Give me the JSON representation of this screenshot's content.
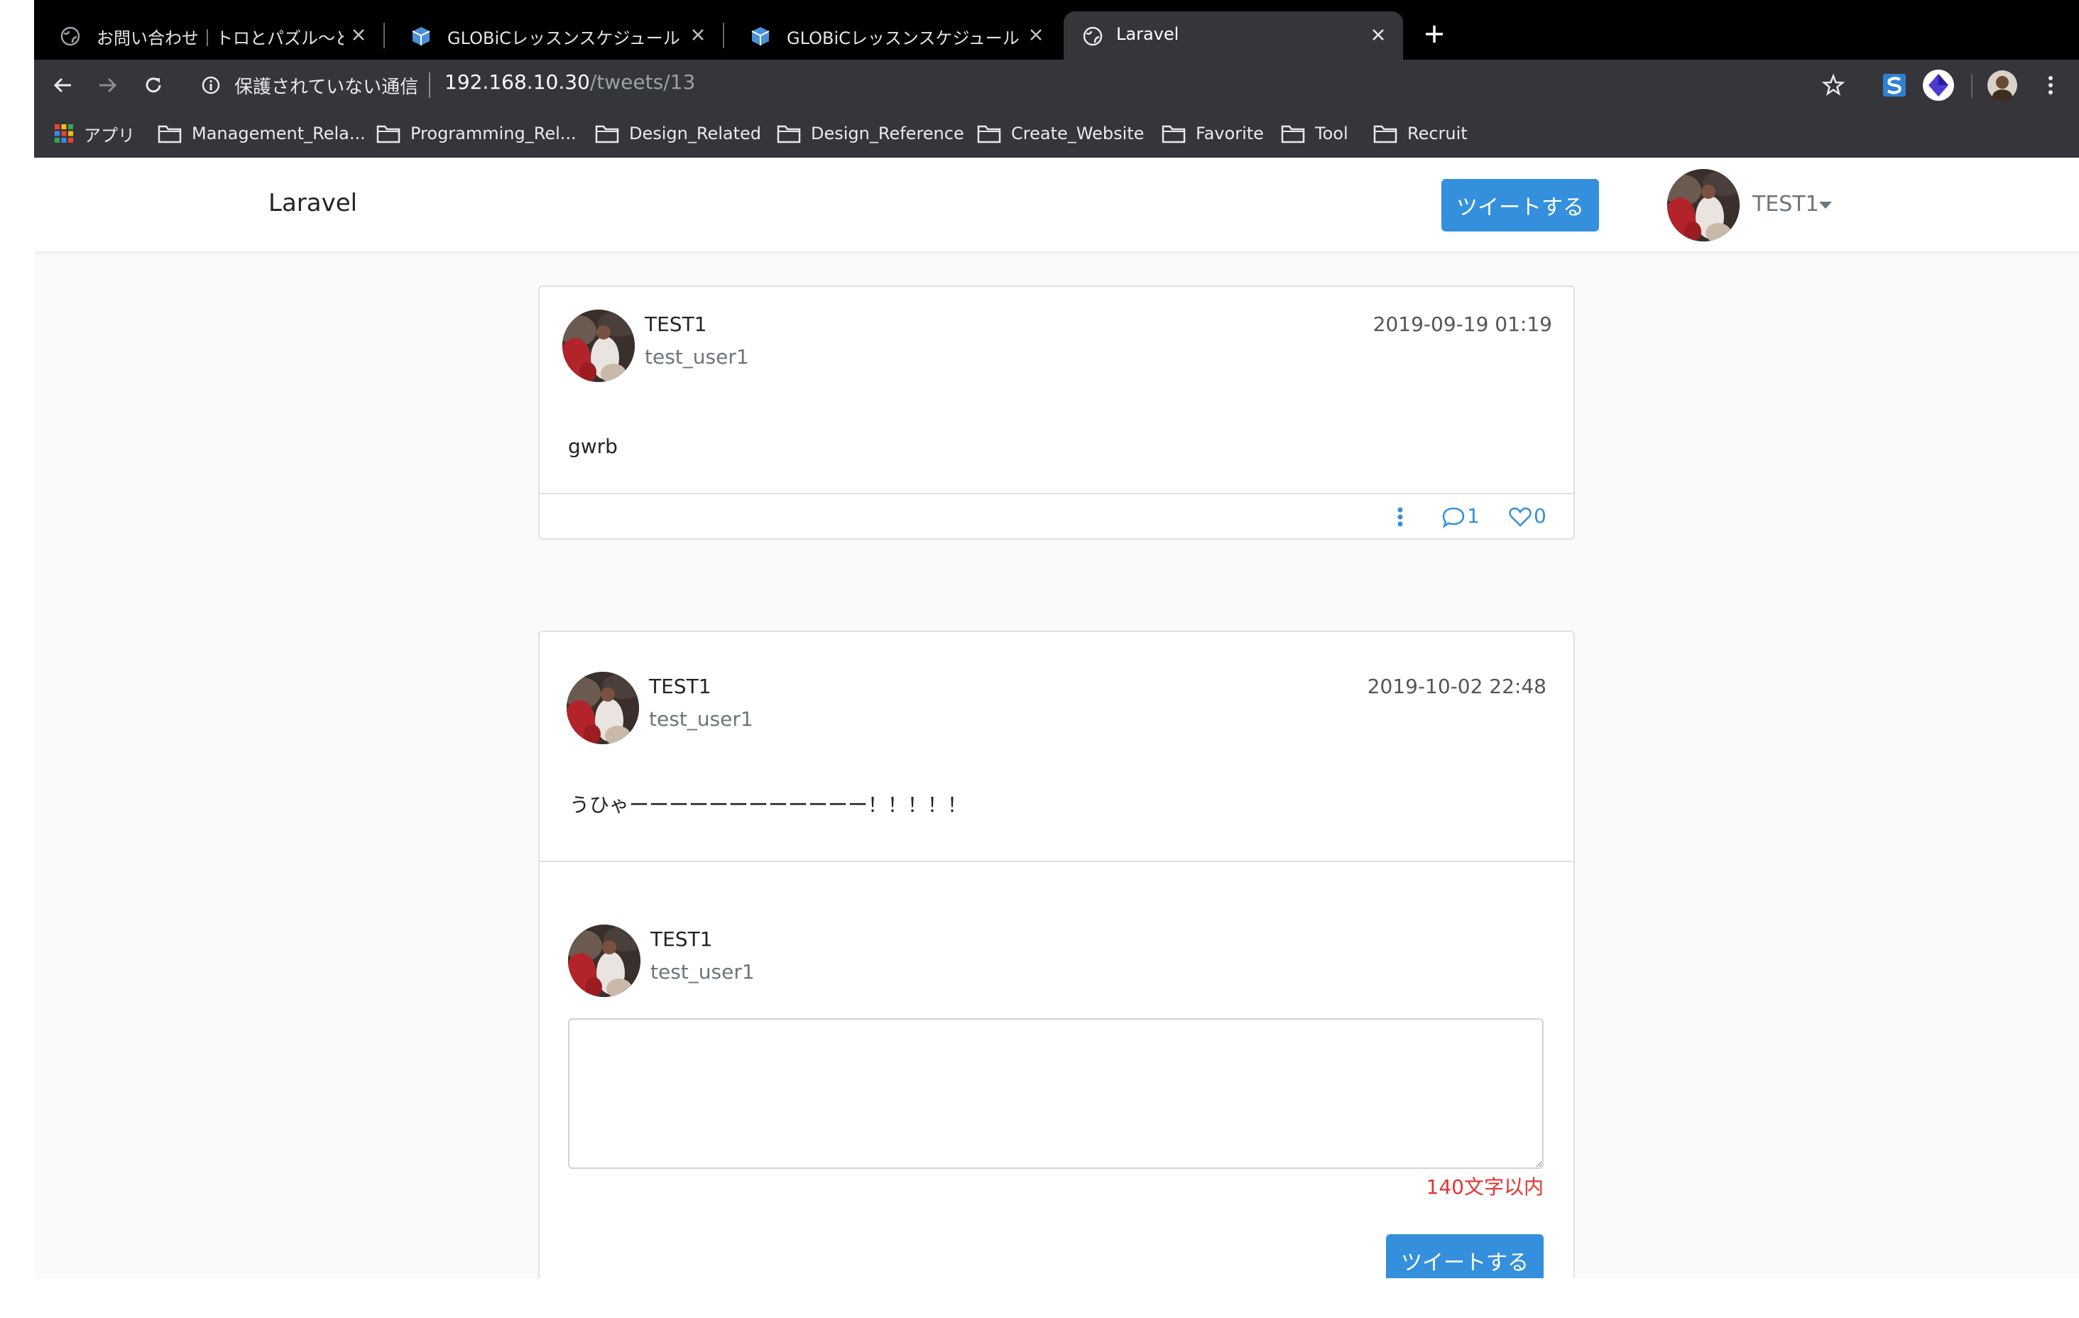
{
  "browser": {
    "tabs": [
      {
        "title": "お問い合わせ｜トロとパズル〜どこ",
        "active": false,
        "favicon": "globe-icon"
      },
      {
        "title": "GLOBiCレッスンスケジュール",
        "active": false,
        "favicon": "cube-icon"
      },
      {
        "title": "GLOBiCレッスンスケジュール",
        "active": false,
        "favicon": "cube-icon"
      },
      {
        "title": "Laravel",
        "active": true,
        "favicon": "globe-icon"
      }
    ],
    "security_label": "保護されていない通信",
    "url_host": "192.168.10.30",
    "url_path": "/tweets/13",
    "bookmarks": [
      {
        "label": "アプリ",
        "icon": "apps-grid-icon"
      },
      {
        "label": "Management_Rela...",
        "icon": "folder-icon"
      },
      {
        "label": "Programming_Rel...",
        "icon": "folder-icon"
      },
      {
        "label": "Design_Related",
        "icon": "folder-icon"
      },
      {
        "label": "Design_Reference",
        "icon": "folder-icon"
      },
      {
        "label": "Create_Website",
        "icon": "folder-icon"
      },
      {
        "label": "Favorite",
        "icon": "folder-icon"
      },
      {
        "label": "Tool",
        "icon": "folder-icon"
      },
      {
        "label": "Recruit",
        "icon": "folder-icon"
      }
    ]
  },
  "navbar": {
    "brand": "Laravel",
    "tweet_button": "ツイートする",
    "user_name": "TEST1"
  },
  "tweet": {
    "name": "TEST1",
    "handle": "test_user1",
    "date": "2019-09-19 01:19",
    "text": "gwrb",
    "comment_count": "1",
    "like_count": "0"
  },
  "comment": {
    "name": "TEST1",
    "handle": "test_user1",
    "date": "2019-10-02 22:48",
    "text": "うひゃーーーーーーーーーーーー！！！！！"
  },
  "reply_form": {
    "name": "TEST1",
    "handle": "test_user1",
    "textarea_value": "",
    "limit_note": "140文字以内",
    "submit_button": "ツイートする"
  },
  "colors": {
    "primary": "#3490dc",
    "danger": "#e3342f",
    "page_bg": "#f8fafc"
  }
}
